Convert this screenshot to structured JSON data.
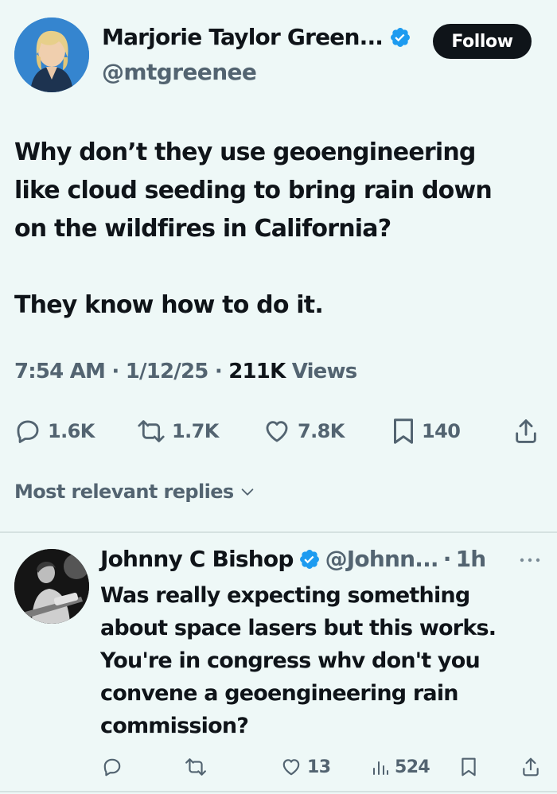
{
  "colors": {
    "background": "#eef8f7",
    "text": "#0f1419",
    "secondary": "#536471",
    "verified": "#1d9bf0",
    "follow_bg": "#0f1419"
  },
  "tweet": {
    "author": {
      "name": "Marjorie Taylor Green...",
      "handle": "@mtgreenee",
      "verified_icon": "verified-badge-icon"
    },
    "follow_label": "Follow",
    "text_lines": [
      "Why don’t they use geoengineering",
      "like cloud seeding to bring rain down",
      "on the wildfires in California?"
    ],
    "text_line_2": "They know how to do it.",
    "time": "7:54 AM",
    "date": "1/12/25",
    "views_count": "211K",
    "views_label": "Views",
    "separator": "·",
    "stats": {
      "replies": "1.6K",
      "retweets": "1.7K",
      "likes": "7.8K",
      "bookmarks": "140"
    }
  },
  "replies_sort_label": "Most relevant replies",
  "reply": {
    "name": "Johnny C Bishop",
    "handle": "@Johnn...",
    "separator": "·",
    "time": "1h",
    "text_lines": [
      "Was really expecting something",
      "about space lasers but this works.",
      "You're in congress whv don't you",
      "convene a geoengineering rain",
      "commission?"
    ],
    "stats": {
      "likes": "13",
      "views": "524"
    }
  }
}
